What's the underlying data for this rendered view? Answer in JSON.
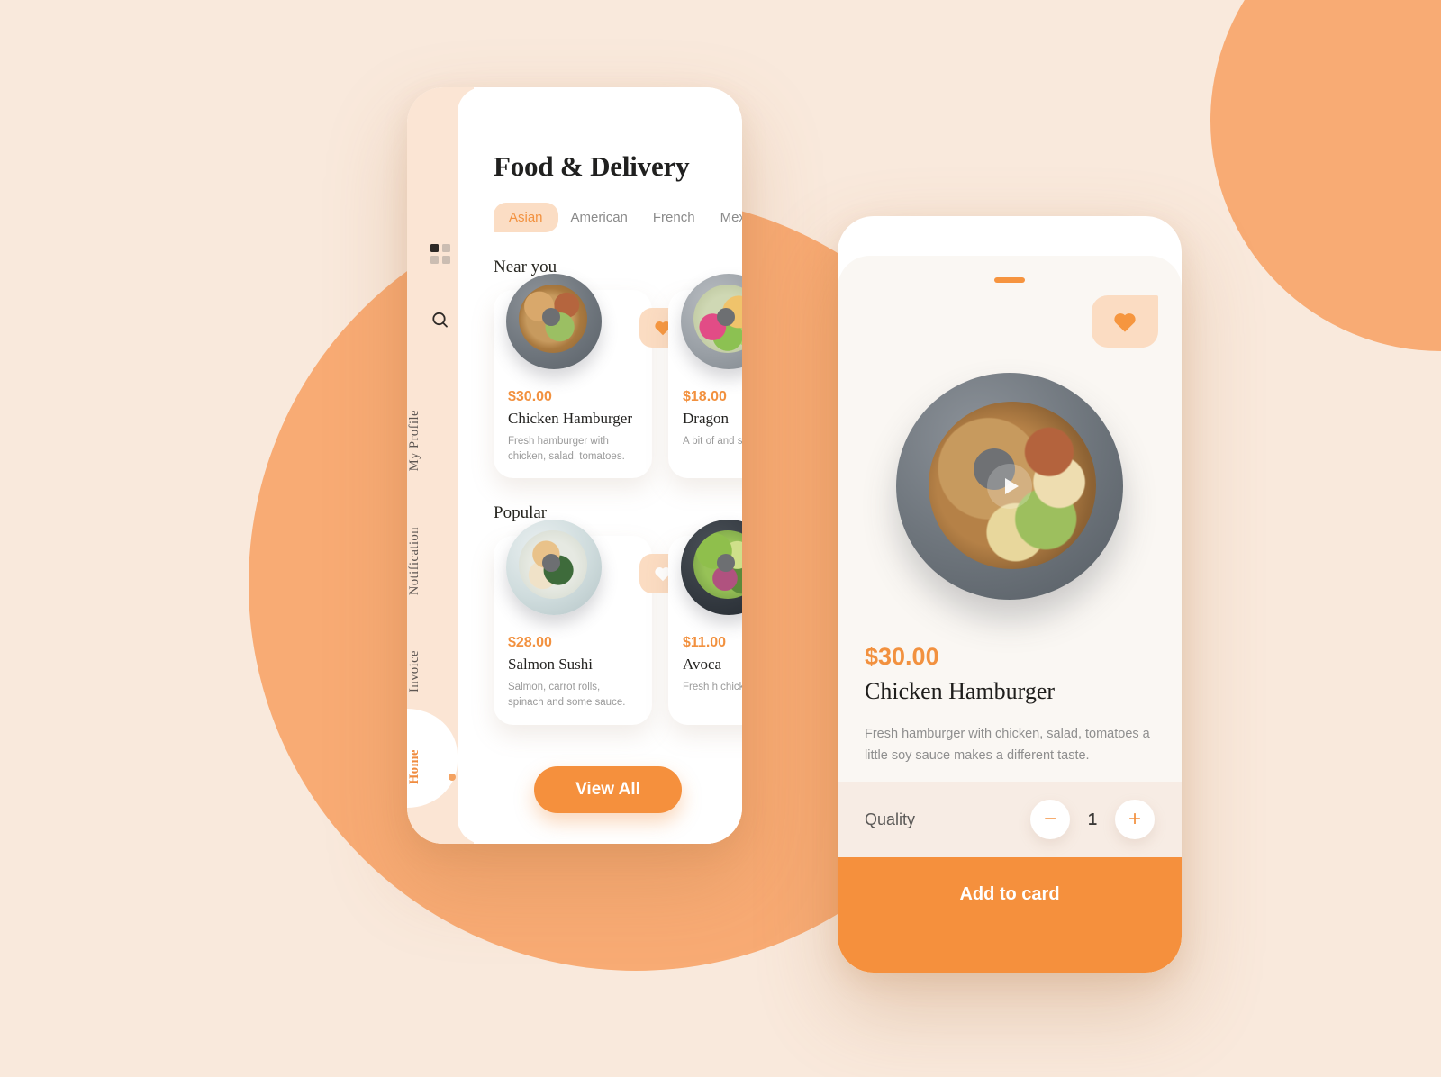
{
  "background": {
    "base_color": "#f9e9dc",
    "blob_color": "#f8ab74"
  },
  "theme": {
    "accent": "#f5903d",
    "accent_text": "#f2913f",
    "peach": "#fbdcc2",
    "sidebar": "#fbe5d4",
    "sheet": "#faf7f3"
  },
  "home_screen": {
    "sidebar": {
      "grid_icon": "grid-icon",
      "search_icon": "search-icon",
      "bag_icon": "shopping-bag-icon",
      "items": [
        {
          "label": "My  Profile",
          "active": false
        },
        {
          "label": "Notification",
          "active": false
        },
        {
          "label": "Invoice",
          "active": false
        },
        {
          "label": "Home",
          "active": true
        }
      ]
    },
    "title": "Food & Delivery",
    "categories": [
      {
        "label": "Asian",
        "active": true
      },
      {
        "label": "American",
        "active": false
      },
      {
        "label": "French",
        "active": false
      },
      {
        "label": "Mexico",
        "active": false
      }
    ],
    "sections": [
      {
        "title": "Near you",
        "cards": [
          {
            "price": "$30.00",
            "name": "Chicken Hamburger",
            "desc": "Fresh hamburger with chicken, salad, tomatoes.",
            "favorite": true
          },
          {
            "price": "$18.00",
            "name": "Dragon",
            "desc": "A bit of and so",
            "favorite": false
          }
        ]
      },
      {
        "title": "Popular",
        "cards": [
          {
            "price": "$28.00",
            "name": "Salmon Sushi",
            "desc": "Salmon, carrot rolls, spinach and some sauce.",
            "favorite": false
          },
          {
            "price": "$11.00",
            "name": "Avoca",
            "desc": "Fresh h chicke",
            "favorite": false
          }
        ]
      }
    ],
    "view_all_label": "View All"
  },
  "detail_screen": {
    "favorite": true,
    "play_icon": "play-icon",
    "price": "$30.00",
    "name": "Chicken Hamburger",
    "desc": "Fresh hamburger with chicken, salad, tomatoes a little soy sauce makes a different taste.",
    "quantity_label": "Quality",
    "quantity_value": "1",
    "decrease_label": "−",
    "increase_label": "+",
    "add_to_cart_label": "Add to card"
  }
}
